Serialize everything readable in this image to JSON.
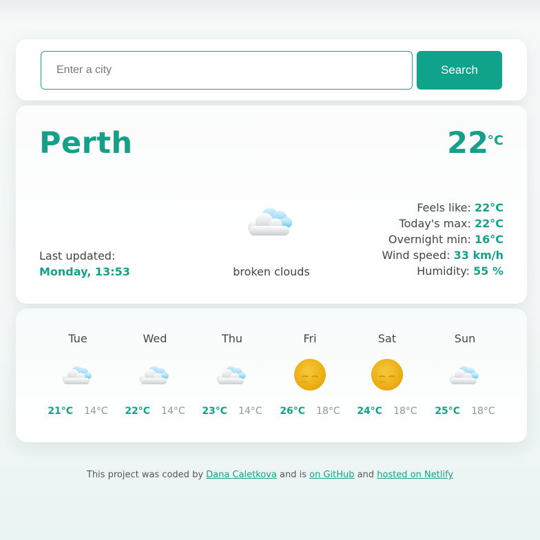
{
  "search": {
    "placeholder": "Enter a city",
    "value": "",
    "button_label": "Search"
  },
  "current": {
    "city": "Perth",
    "temperature": "22",
    "unit": "°C",
    "updated_label": "Last updated:",
    "updated_value": "Monday, 13:53",
    "icon": "broken-clouds-icon",
    "description": "broken clouds",
    "details": [
      {
        "label": "Feels like: ",
        "value": "22°C"
      },
      {
        "label": "Today's max: ",
        "value": "22°C"
      },
      {
        "label": "Overnight min: ",
        "value": "16°C"
      },
      {
        "label": "Wind speed: ",
        "value": "33 km/h"
      },
      {
        "label": "Humidity: ",
        "value": "55 %"
      }
    ]
  },
  "forecast": [
    {
      "day": "Tue",
      "icon": "broken-clouds-icon",
      "max": "21°C",
      "min": "14°C"
    },
    {
      "day": "Wed",
      "icon": "broken-clouds-icon",
      "max": "22°C",
      "min": "14°C"
    },
    {
      "day": "Thu",
      "icon": "broken-clouds-icon",
      "max": "23°C",
      "min": "14°C"
    },
    {
      "day": "Fri",
      "icon": "sun-icon",
      "max": "26°C",
      "min": "18°C"
    },
    {
      "day": "Sat",
      "icon": "sun-icon",
      "max": "24°C",
      "min": "18°C"
    },
    {
      "day": "Sun",
      "icon": "broken-clouds-icon",
      "max": "25°C",
      "min": "18°C"
    }
  ],
  "footer": {
    "text1": "This project was coded by ",
    "link1": "Dana Caletkova",
    "text2": " and is ",
    "link2": "on GitHub",
    "text3": " and ",
    "link3": "hosted on Netlify"
  },
  "colors": {
    "accent": "#16a08a",
    "button": "#0fa38c",
    "sun": "#f2b418"
  }
}
